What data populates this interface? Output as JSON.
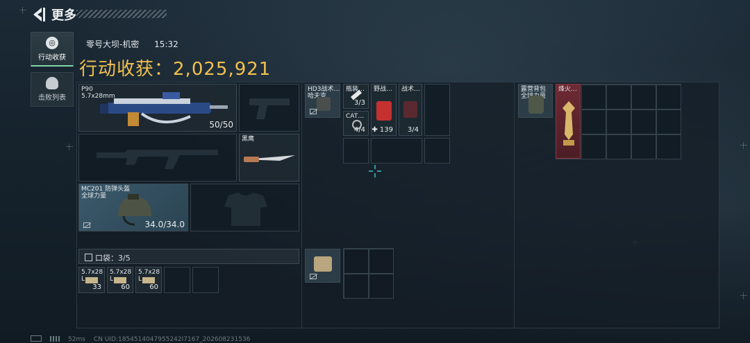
{
  "header": {
    "title": "更多"
  },
  "tabs": [
    {
      "label": "行动收获",
      "icon": "target-icon"
    },
    {
      "label": "击败列表",
      "icon": "soldier-icon"
    }
  ],
  "raid": {
    "map": "零号大坝-机密",
    "time": "15:32",
    "income_label": "行动收获：",
    "income_value": "2,025,921"
  },
  "weapons": {
    "primary": {
      "name": "P90",
      "caliber": "5.7x28mm",
      "ammo": "50/50"
    },
    "knife": {
      "name": "黑鹰"
    },
    "helmet": {
      "name": "MC201 防弹头盔",
      "sub": "全球力量",
      "durability": "34.0/34.0"
    }
  },
  "pocket": {
    "label": "口袋：3/5",
    "items": [
      {
        "name": "5.7x28 L",
        "count": "33"
      },
      {
        "name": "5.7x28 L",
        "count": "60"
      },
      {
        "name": "5.7x28 L",
        "count": "60"
      }
    ]
  },
  "chest_rig": {
    "items": [
      {
        "name": "HD3战术…",
        "sub": "哈夫克"
      },
      {
        "name": "瓶装…",
        "count": "3/3"
      },
      {
        "name": "CAT…",
        "count": "4/4"
      },
      {
        "name": "野战…",
        "count": "139"
      },
      {
        "name": "战术…",
        "count": "3/4"
      }
    ]
  },
  "backpack": {
    "items": [
      {
        "name": "露营背包",
        "sub": "全球力量"
      },
      {
        "name": "烽火…"
      }
    ]
  },
  "footer": {
    "ping": "52ms",
    "uid": "CN UID:1854514047955242I7167_202608231536"
  },
  "colors": {
    "accent": "#f2c14e",
    "active_tab": "#7fd6a8",
    "panel": "#141e26"
  }
}
